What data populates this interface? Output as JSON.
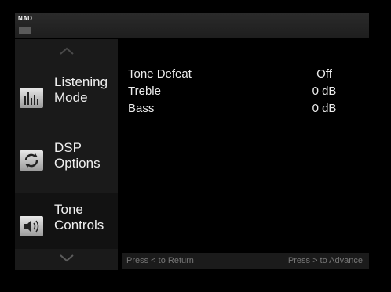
{
  "header": {
    "brand": "NAD"
  },
  "sidebar": {
    "items": [
      {
        "label_line1": "Listening",
        "label_line2": "Mode",
        "icon": "bars-icon"
      },
      {
        "label_line1": "DSP",
        "label_line2": "Options",
        "icon": "cycle-icon"
      },
      {
        "label_line1": "Tone",
        "label_line2": "Controls",
        "icon": "speaker-icon"
      }
    ],
    "active_index": 2
  },
  "settings": {
    "rows": [
      {
        "name": "Tone Defeat",
        "value": "Off"
      },
      {
        "name": "Treble",
        "value": "0 dB"
      },
      {
        "name": "Bass",
        "value": "0 dB"
      }
    ]
  },
  "footer": {
    "left": "Press < to Return",
    "right": "Press > to Advance"
  }
}
